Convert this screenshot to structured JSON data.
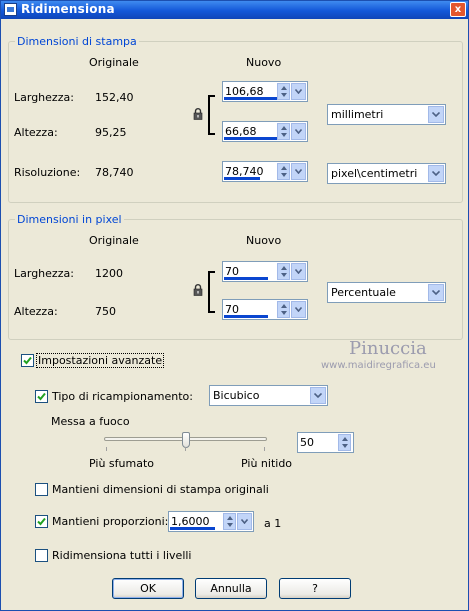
{
  "window": {
    "title": "Ridimensiona",
    "close_glyph": "x"
  },
  "print_group": {
    "legend": "Dimensioni di stampa",
    "col_original": "Originale",
    "col_new": "Nuovo",
    "width_label": "Larghezza:",
    "width_original": "152,40",
    "width_new": "106,68",
    "height_label": "Altezza:",
    "height_original": "95,25",
    "height_new": "66,68",
    "unit": "millimetri",
    "res_label": "Risoluzione:",
    "res_original": "78,740",
    "res_new": "78,740",
    "res_unit": "pixel\\centimetri"
  },
  "pixel_group": {
    "legend": "Dimensioni in pixel",
    "col_original": "Originale",
    "col_new": "Nuovo",
    "width_label": "Larghezza:",
    "width_original": "1200",
    "width_new": "70",
    "height_label": "Altezza:",
    "height_original": "750",
    "height_new": "70",
    "unit": "Percentuale"
  },
  "advanced": {
    "label": "Impostazioni avanzate",
    "checked": true
  },
  "resample": {
    "label": "Tipo di ricampionamento:",
    "checked": true,
    "value": "Bicubico"
  },
  "sharpen": {
    "label": "Messa a fuoco",
    "left_label": "Più sfumato",
    "right_label": "Più nitido",
    "value": "50",
    "level": 0.5
  },
  "keep_print": {
    "label": "Mantieni dimensioni di stampa originali",
    "checked": false
  },
  "keep_ratio": {
    "label": "Mantieni proporzioni:",
    "checked": true,
    "value": "1,6000",
    "suffix": "a 1"
  },
  "all_layers": {
    "label": "Ridimensiona tutti i livelli",
    "checked": false
  },
  "buttons": {
    "ok": "OK",
    "cancel": "Annulla",
    "help": "?"
  },
  "watermark": {
    "name": "Pinuccia",
    "url": "www.maidiregrafica.eu"
  },
  "icons": {
    "lock": "lock-icon",
    "spin": "spin-arrows-icon",
    "dropdown": "chevron-down-icon",
    "check": "check-icon"
  },
  "colors": {
    "title_bar": "#1357D8",
    "group_legend": "#0046D5",
    "dialog_bg": "#ECE9D8",
    "value_bar": "#0A46D0"
  }
}
